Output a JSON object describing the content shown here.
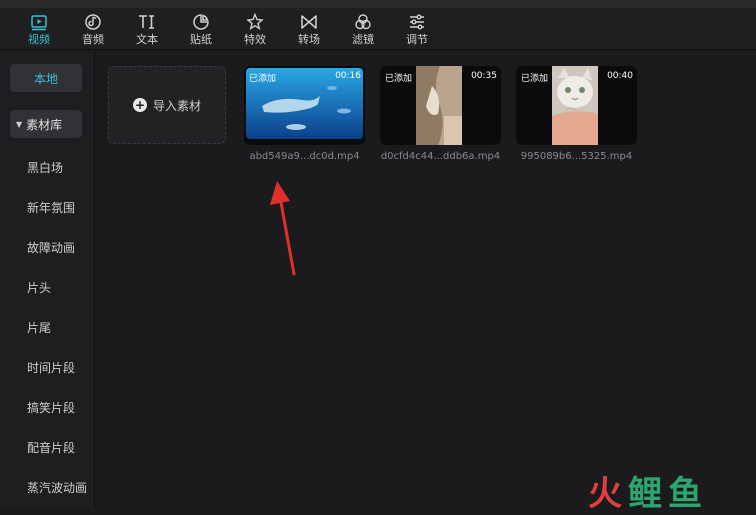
{
  "toolbar": {
    "tabs": [
      {
        "label": "视频",
        "icon": "video-play-icon",
        "active": true
      },
      {
        "label": "音频",
        "icon": "music-note-icon",
        "active": false
      },
      {
        "label": "文本",
        "icon": "text-ti-icon",
        "active": false
      },
      {
        "label": "贴纸",
        "icon": "sticker-icon",
        "active": false
      },
      {
        "label": "特效",
        "icon": "sparkle-star-icon",
        "active": false
      },
      {
        "label": "转场",
        "icon": "bowtie-transition-icon",
        "active": false
      },
      {
        "label": "滤镜",
        "icon": "three-circles-filter-icon",
        "active": false
      },
      {
        "label": "调节",
        "icon": "sliders-adjust-icon",
        "active": false
      }
    ]
  },
  "sidebar": {
    "local_label": "本地",
    "library_label": "素材库",
    "categories": [
      "黑白场",
      "新年氛围",
      "故障动画",
      "片头",
      "片尾",
      "时间片段",
      "搞笑片段",
      "配音片段",
      "蒸汽波动画"
    ]
  },
  "main": {
    "import_label": "导入素材",
    "media": [
      {
        "badge": "已添加",
        "duration": "00:16",
        "filename": "abd549a9...dc0d.mp4",
        "thumb": "underwater-whale-shark"
      },
      {
        "badge": "已添加",
        "duration": "00:35",
        "filename": "d0cfd4c44...ddb6a.mp4",
        "thumb": "cat-vertical-clip"
      },
      {
        "badge": "已添加",
        "duration": "00:40",
        "filename": "995089b6...5325.mp4",
        "thumb": "white-cat-face"
      }
    ]
  },
  "watermark": {
    "part1": "火",
    "part2": "鲤鱼"
  },
  "colors": {
    "accent": "#35c2d9",
    "background": "#1b1b1d",
    "arrow": "#e0302b"
  }
}
